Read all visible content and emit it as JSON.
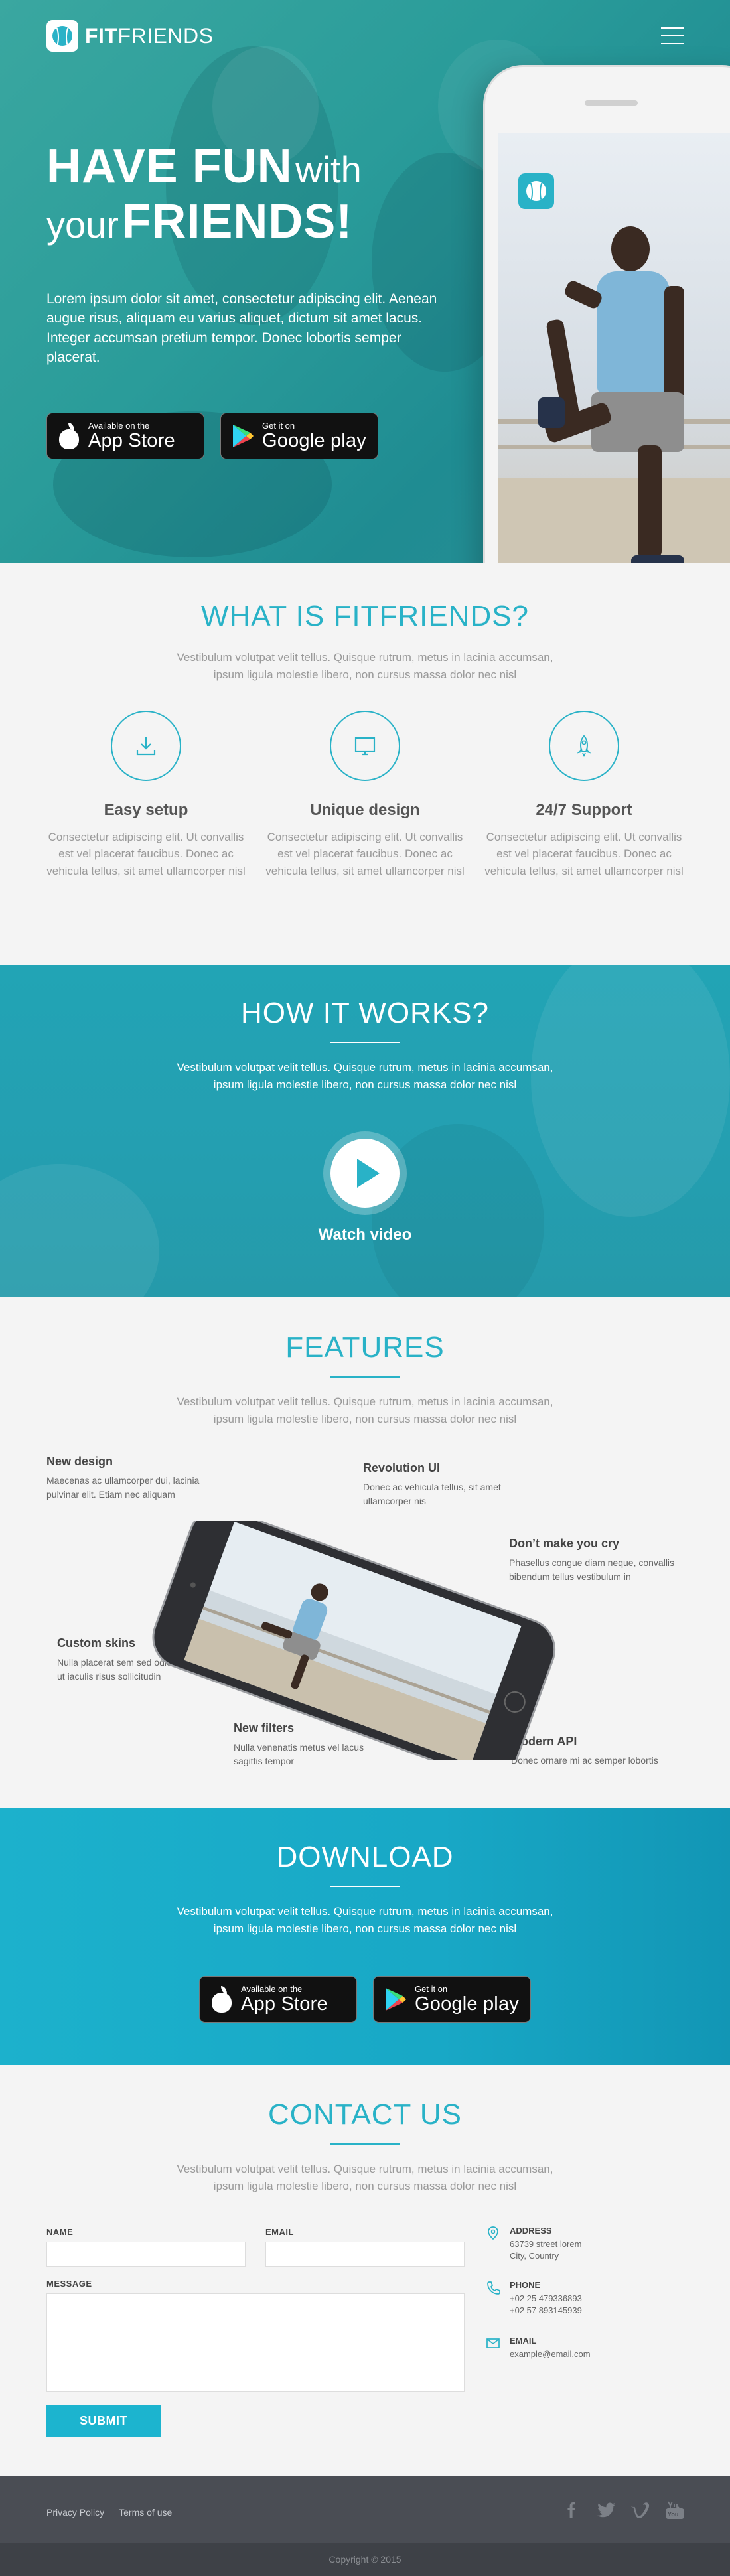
{
  "brand": {
    "name_bold": "FIT",
    "name_regular": "FRIENDS"
  },
  "colors": {
    "accent": "#29b2c7",
    "button": "#1cb4cf",
    "footer": "#4a4d54"
  },
  "hero": {
    "title_big_1": "HAVE FUN",
    "title_small_1": "with",
    "title_small_2": "your",
    "title_big_2": "FRIENDS!",
    "description": "Lorem ipsum dolor sit amet, consectetur adipiscing elit. Aenean augue risus, aliquam eu varius aliquet, dictum sit amet lacus. Integer accumsan pretium tempor. Donec lobortis semper placerat."
  },
  "stores": {
    "apple_small": "Available on the",
    "apple_big": "App Store",
    "google_small": "Get it on",
    "google_big": "Google play"
  },
  "what": {
    "title": "WHAT IS FITFRIENDS?",
    "desc_1": "Vestibulum volutpat velit tellus. Quisque rutrum, metus in lacinia accumsan,",
    "desc_2": "ipsum ligula molestie libero, non cursus massa dolor nec nisl",
    "items": [
      {
        "icon": "download-icon",
        "title": "Easy setup",
        "text": "Consectetur adipiscing elit. Ut convallis est vel placerat faucibus. Donec ac vehicula tellus, sit amet ullamcorper nisl"
      },
      {
        "icon": "monitor-icon",
        "title": "Unique design",
        "text": "Consectetur adipiscing elit. Ut convallis est vel placerat faucibus. Donec ac vehicula tellus, sit amet ullamcorper nisl"
      },
      {
        "icon": "rocket-icon",
        "title": "24/7 Support",
        "text": "Consectetur adipiscing elit. Ut convallis est vel placerat faucibus. Donec ac vehicula tellus, sit amet ullamcorper nisl"
      }
    ]
  },
  "how": {
    "title": "HOW IT WORKS?",
    "desc_1": "Vestibulum volutpat velit tellus. Quisque rutrum, metus in lacinia accumsan,",
    "desc_2": "ipsum ligula molestie libero, non cursus massa dolor nec nisl",
    "watch": "Watch video"
  },
  "features": {
    "title": "FEATURES",
    "desc_1": "Vestibulum volutpat velit tellus. Quisque rutrum, metus in lacinia accumsan,",
    "desc_2": "ipsum ligula molestie libero, non cursus massa dolor nec nisl",
    "items": [
      {
        "title": "New design",
        "text_1": "Maecenas ac ullamcorper dui, lacinia",
        "text_2": "pulvinar elit. Etiam nec aliquam"
      },
      {
        "title": "Revolution UI",
        "text_1": " Donec ac vehicula tellus, sit amet",
        "text_2": "ullamcorper nis"
      },
      {
        "title": "Don’t make you cry",
        "text_1": "Phasellus congue diam neque, convallis",
        "text_2": "bibendum tellus vestibulum in"
      },
      {
        "title": "Custom skins",
        "text_1": "Nulla placerat sem sed odio interdum,",
        "text_2": "ut iaculis risus sollicitudin"
      },
      {
        "title": "New filters",
        "text_1": "Nulla venenatis metus vel lacus",
        "text_2": "sagittis tempor"
      },
      {
        "title": "Modern API",
        "text_1": "Donec ornare mi ac semper lobortis",
        "text_2": ""
      }
    ]
  },
  "download": {
    "title": "DOWNLOAD",
    "desc_1": "Vestibulum volutpat velit tellus. Quisque rutrum, metus in lacinia accumsan,",
    "desc_2": "ipsum ligula molestie libero, non cursus massa dolor nec nisl"
  },
  "contact": {
    "title": "CONTACT US",
    "desc_1": "Vestibulum volutpat velit tellus. Quisque rutrum, metus in lacinia accumsan,",
    "desc_2": "ipsum ligula molestie libero, non cursus massa dolor nec nisl",
    "name_label": "NAME",
    "email_label": "EMAIL",
    "message_label": "MESSAGE",
    "submit": "SUBMIT",
    "address_title": "ADDRESS",
    "address_1": "63739 street lorem",
    "address_2": "City, Country",
    "phone_title": "PHONE",
    "phone_1": "+02 25 479336893",
    "phone_2": "+02 57 893145939",
    "email_title": "EMAIL",
    "email_value": "example@email.com"
  },
  "footer": {
    "privacy": "Privacy Policy",
    "terms": "Terms of use",
    "copyright": "Copyright © 2015",
    "social": [
      "facebook-icon",
      "twitter-icon",
      "vimeo-icon",
      "youtube-icon"
    ]
  }
}
